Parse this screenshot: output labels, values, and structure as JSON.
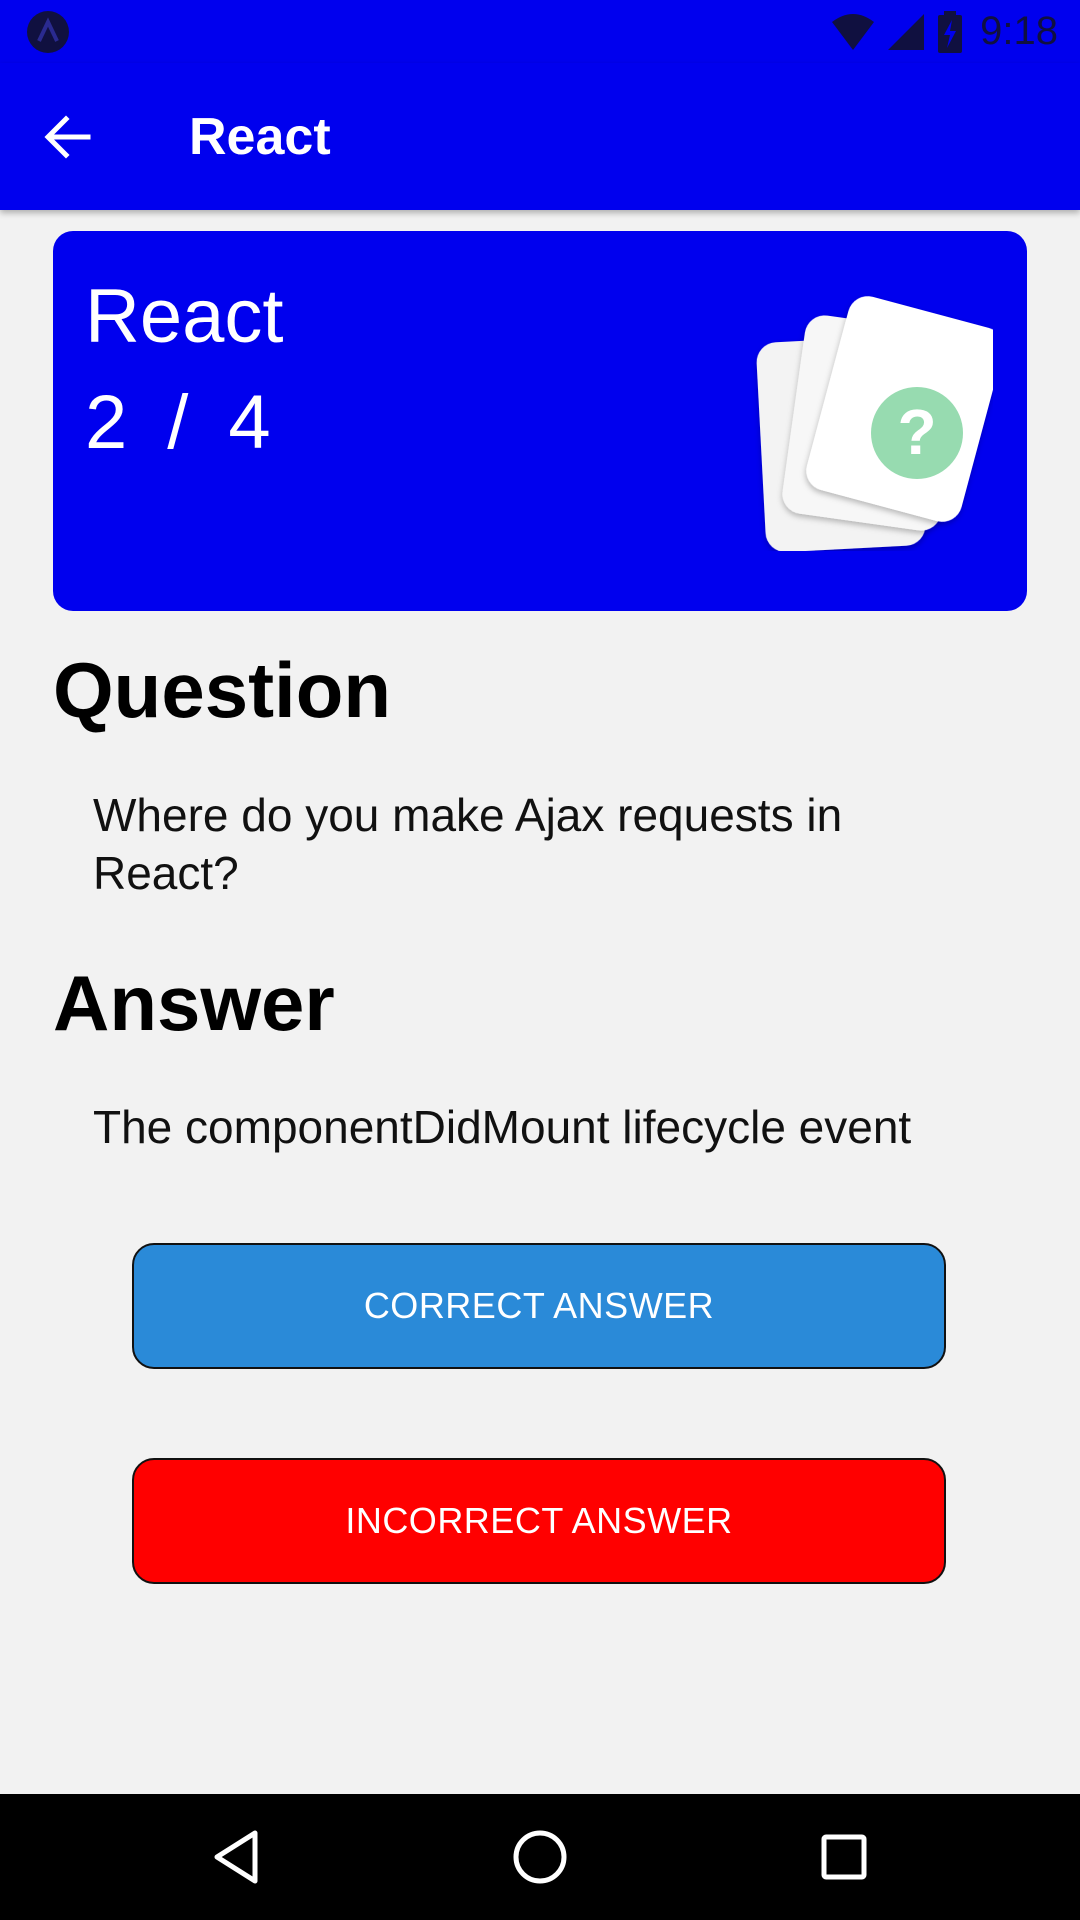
{
  "status_bar": {
    "time": "9:18",
    "icons": [
      "app-notification-icon",
      "wifi-icon",
      "cell-signal-icon",
      "battery-charging-icon"
    ]
  },
  "app_bar": {
    "title": "React",
    "back_icon": "arrow-left-icon"
  },
  "deck": {
    "title": "React",
    "current": "2",
    "separator": "/",
    "total": "4",
    "illustration_icon": "question-cards-icon"
  },
  "question": {
    "heading": "Question",
    "text": "Where do you make Ajax requests in React?"
  },
  "answer": {
    "heading": "Answer",
    "text": "The componentDidMount lifecycle event"
  },
  "buttons": {
    "correct_label": "CORRECT ANSWER",
    "incorrect_label": "INCORRECT ANSWER"
  },
  "colors": {
    "primary": "#0000ee",
    "background": "#f2f2f2",
    "correct_button": "#2a8ad8",
    "incorrect_button": "#ff0000",
    "question_mark_circle": "#97dbb0"
  },
  "nav_bar": {
    "icons": [
      "nav-back-icon",
      "nav-home-icon",
      "nav-recent-icon"
    ]
  }
}
